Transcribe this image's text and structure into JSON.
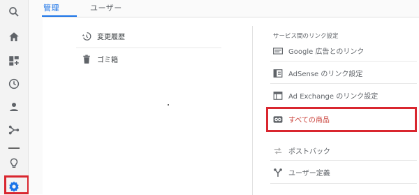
{
  "tabs": [
    {
      "label": "管理",
      "active": true
    },
    {
      "label": "ユーザー",
      "active": false
    }
  ],
  "left_column": [
    {
      "label": "変更履歴",
      "icon": "history-icon"
    },
    {
      "label": "ゴミ箱",
      "icon": "trash-icon"
    }
  ],
  "right_column": {
    "section_title": "サービス間のリンク設定",
    "items": [
      {
        "label": "Google 広告とのリンク",
        "icon": "google-ads-icon"
      },
      {
        "label": "AdSense のリンク設定",
        "icon": "adsense-icon"
      },
      {
        "label": "Ad Exchange のリンク設定",
        "icon": "ad-exchange-icon"
      },
      {
        "label": "すべての商品",
        "icon": "link-icon",
        "highlighted": true
      },
      {
        "label": "ポストバック",
        "icon": "postback-icon"
      },
      {
        "label": "ユーザー定義",
        "icon": "custom-definition-icon"
      }
    ]
  },
  "rail": {
    "items": [
      "search-icon",
      "home-icon",
      "customization-icon",
      "realtime-icon",
      "audience-icon",
      "acquisition-icon",
      "discover-icon",
      "settings-icon"
    ]
  },
  "colors": {
    "accent": "#1a73e8",
    "highlight": "#d9262f",
    "link_red": "#c9413a"
  }
}
